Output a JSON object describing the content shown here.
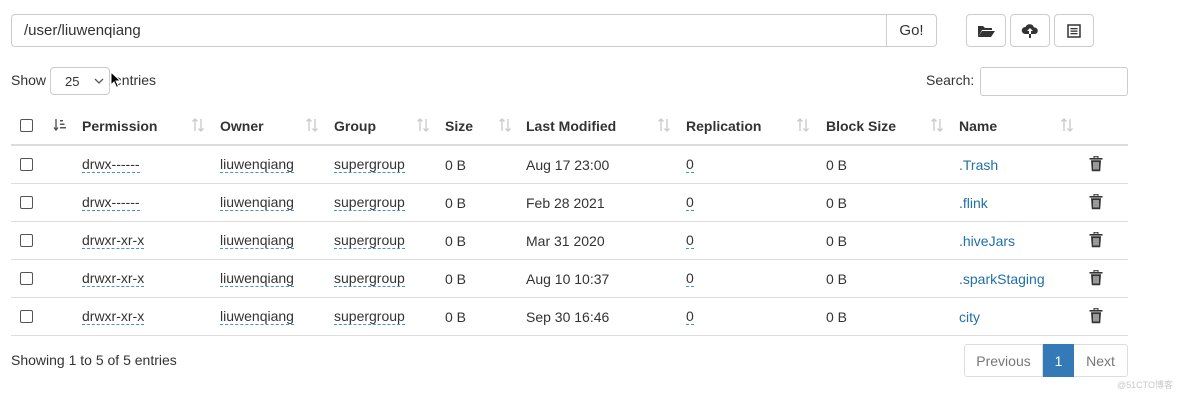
{
  "path_bar": {
    "value": "/user/liuwenqiang",
    "go_label": "Go!"
  },
  "toolbar": {
    "icons": [
      "folder-open-icon",
      "cloud-upload-icon",
      "list-icon"
    ]
  },
  "length_control": {
    "show_label": "Show",
    "selected": "25",
    "entries_label": "entries"
  },
  "search": {
    "label": "Search:",
    "value": ""
  },
  "table": {
    "columns": [
      "Permission",
      "Owner",
      "Group",
      "Size",
      "Last Modified",
      "Replication",
      "Block Size",
      "Name"
    ],
    "rows": [
      {
        "permission": "drwx------",
        "owner": "liuwenqiang",
        "group": "supergroup",
        "size": "0 B",
        "modified": "Aug 17 23:00",
        "replication": "0",
        "block_size": "0 B",
        "name": ".Trash"
      },
      {
        "permission": "drwx------",
        "owner": "liuwenqiang",
        "group": "supergroup",
        "size": "0 B",
        "modified": "Feb 28 2021",
        "replication": "0",
        "block_size": "0 B",
        "name": ".flink"
      },
      {
        "permission": "drwxr-xr-x",
        "owner": "liuwenqiang",
        "group": "supergroup",
        "size": "0 B",
        "modified": "Mar 31 2020",
        "replication": "0",
        "block_size": "0 B",
        "name": ".hiveJars"
      },
      {
        "permission": "drwxr-xr-x",
        "owner": "liuwenqiang",
        "group": "supergroup",
        "size": "0 B",
        "modified": "Aug 10 10:37",
        "replication": "0",
        "block_size": "0 B",
        "name": ".sparkStaging"
      },
      {
        "permission": "drwxr-xr-x",
        "owner": "liuwenqiang",
        "group": "supergroup",
        "size": "0 B",
        "modified": "Sep 30 16:46",
        "replication": "0",
        "block_size": "0 B",
        "name": "city"
      }
    ]
  },
  "footer": {
    "info": "Showing 1 to 5 of 5 entries"
  },
  "pagination": {
    "previous": "Previous",
    "current": "1",
    "next": "Next"
  },
  "watermark": "@51CTO博客",
  "colors": {
    "link": "#1f6fa8",
    "active_page": "#337ab7",
    "border": "#dddddd"
  }
}
